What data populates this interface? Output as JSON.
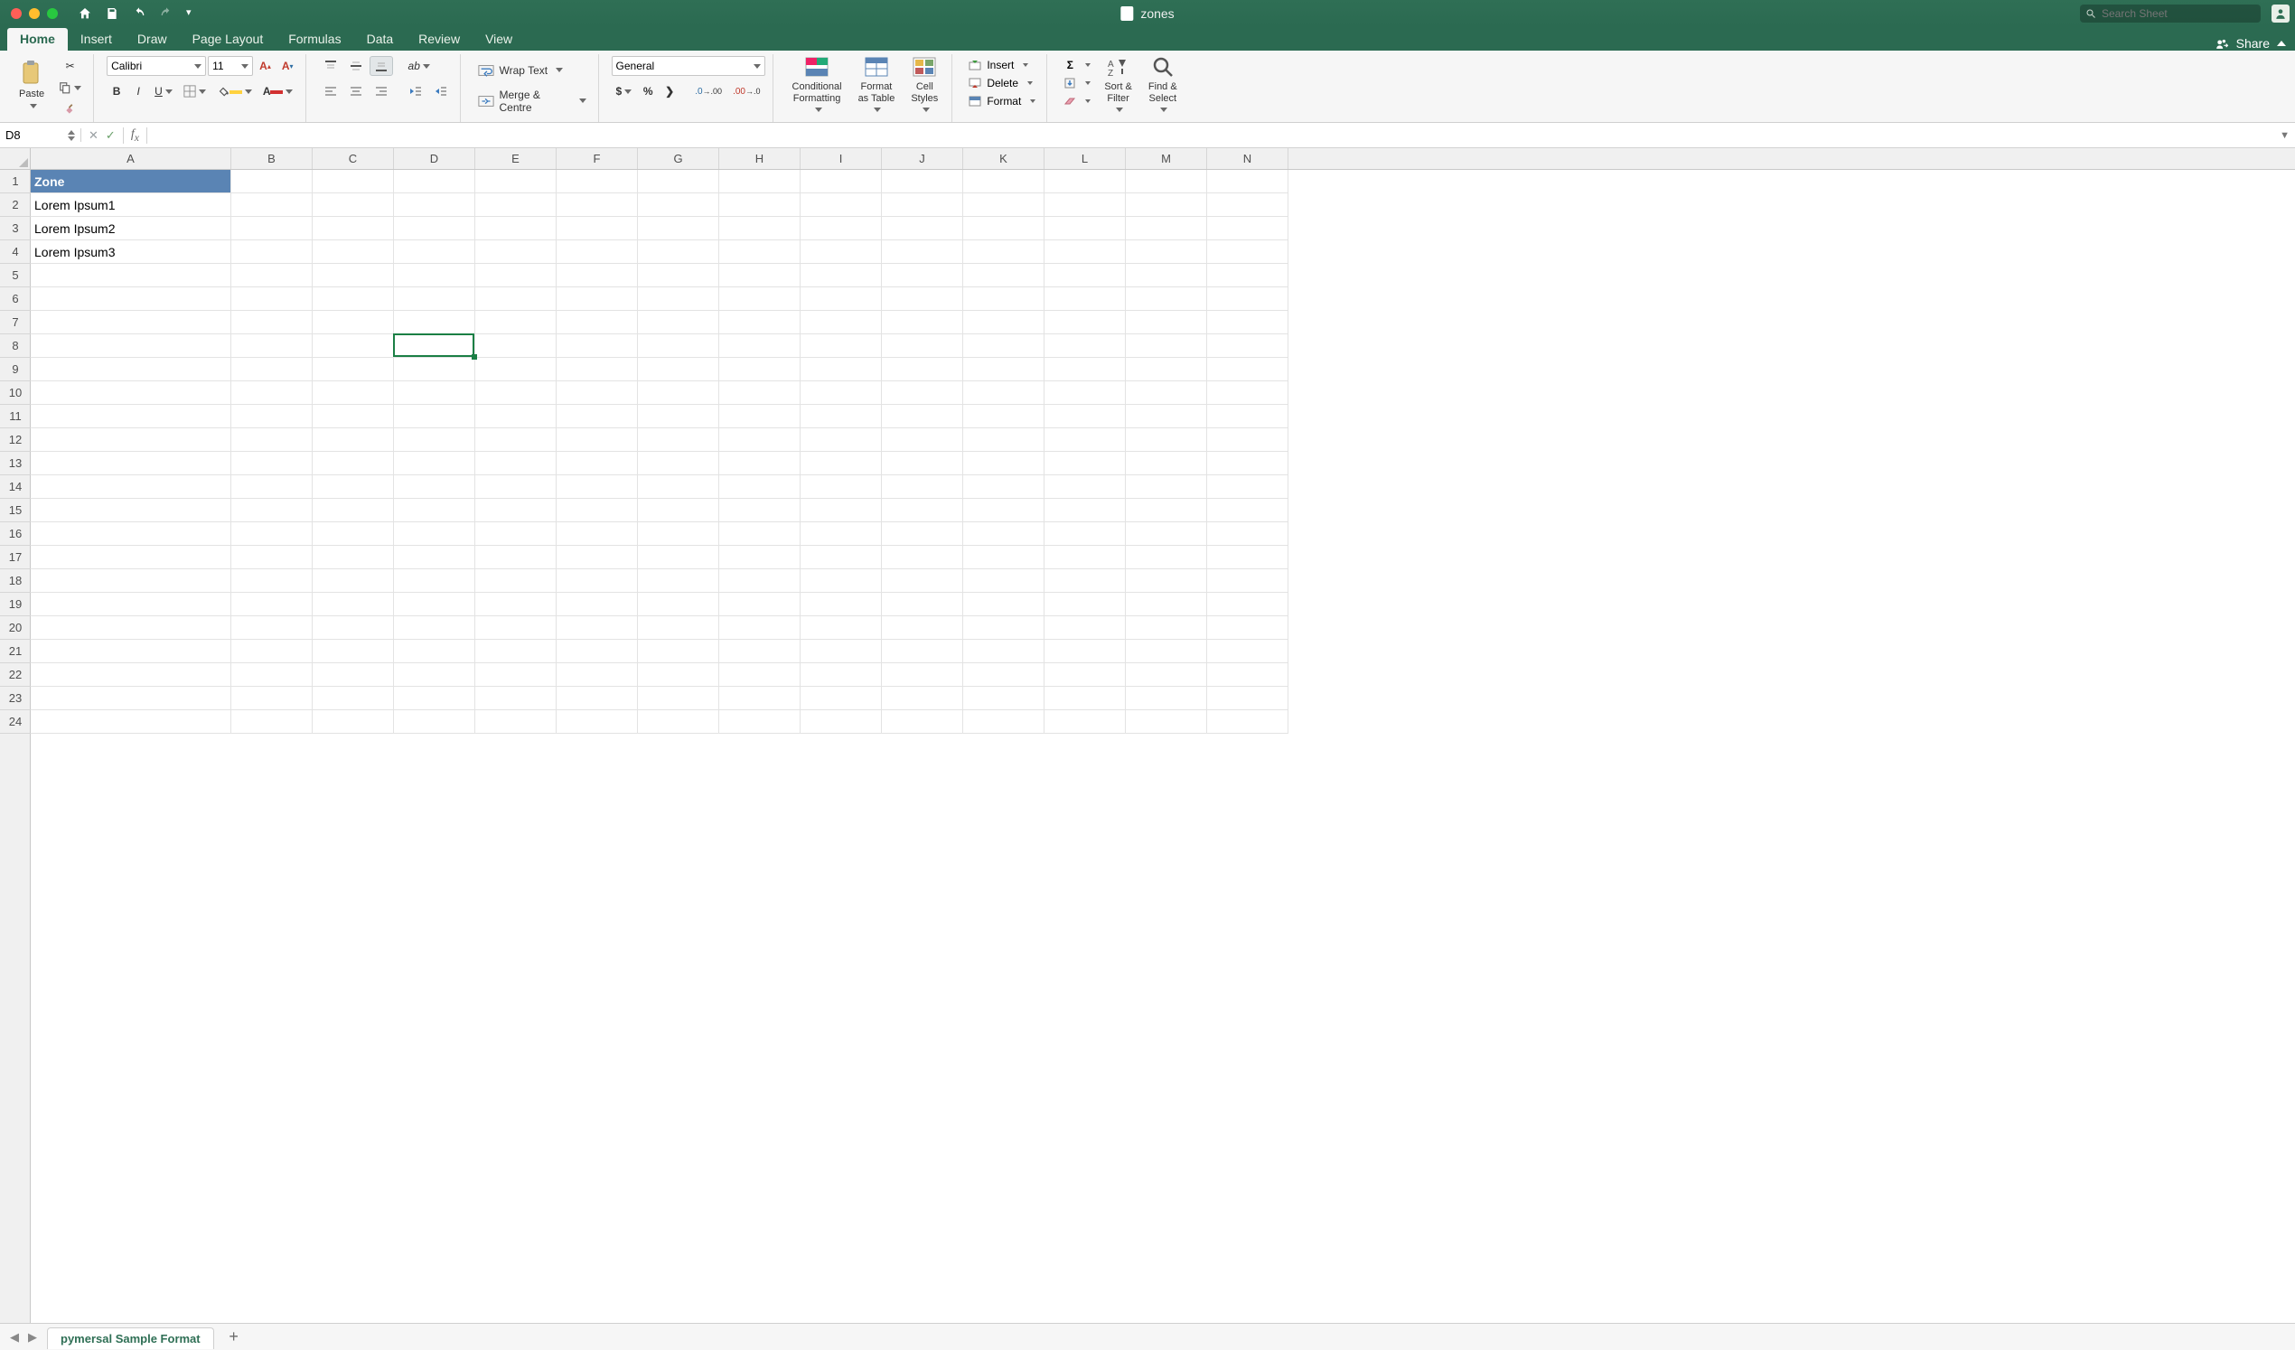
{
  "title": {
    "filename": "zones"
  },
  "search": {
    "placeholder": "Search Sheet"
  },
  "share": {
    "label": "Share"
  },
  "ribbon_tabs": {
    "items": [
      "Home",
      "Insert",
      "Draw",
      "Page Layout",
      "Formulas",
      "Data",
      "Review",
      "View"
    ],
    "active": "Home"
  },
  "font": {
    "name": "Calibri",
    "size": "11"
  },
  "clipboard": {
    "paste_label": "Paste"
  },
  "alignment": {
    "wrap_label": "Wrap Text",
    "merge_label": "Merge & Centre"
  },
  "number": {
    "format": "General"
  },
  "styles": {
    "conditional": "Conditional\nFormatting",
    "as_table": "Format\nas Table",
    "cell_styles": "Cell\nStyles"
  },
  "cells_group": {
    "insert": "Insert",
    "delete": "Delete",
    "format": "Format"
  },
  "editing": {
    "sort": "Sort &\nFilter",
    "find": "Find &\nSelect"
  },
  "namebox": {
    "value": "D8"
  },
  "formula_bar": {
    "value": ""
  },
  "columns": {
    "labels": [
      "A",
      "B",
      "C",
      "D",
      "E",
      "F",
      "G",
      "H",
      "I",
      "J",
      "K",
      "L",
      "M",
      "N"
    ],
    "widths": [
      222,
      90,
      90,
      90,
      90,
      90,
      90,
      90,
      90,
      90,
      90,
      90,
      90,
      90
    ]
  },
  "rows": {
    "count": 24
  },
  "data": {
    "A1": {
      "value": "Zone",
      "is_header": true
    },
    "A2": {
      "value": "Lorem Ipsum1"
    },
    "A3": {
      "value": "Lorem Ipsum2"
    },
    "A4": {
      "value": "Lorem Ipsum3"
    }
  },
  "selection": {
    "col": 3,
    "row": 7,
    "label": "D8"
  },
  "sheets": {
    "active": "pymersal Sample Format"
  },
  "colors": {
    "titlebar": "#2b6a51",
    "header_cell_bg": "#5a84b4",
    "selection_border": "#1b7f45"
  }
}
